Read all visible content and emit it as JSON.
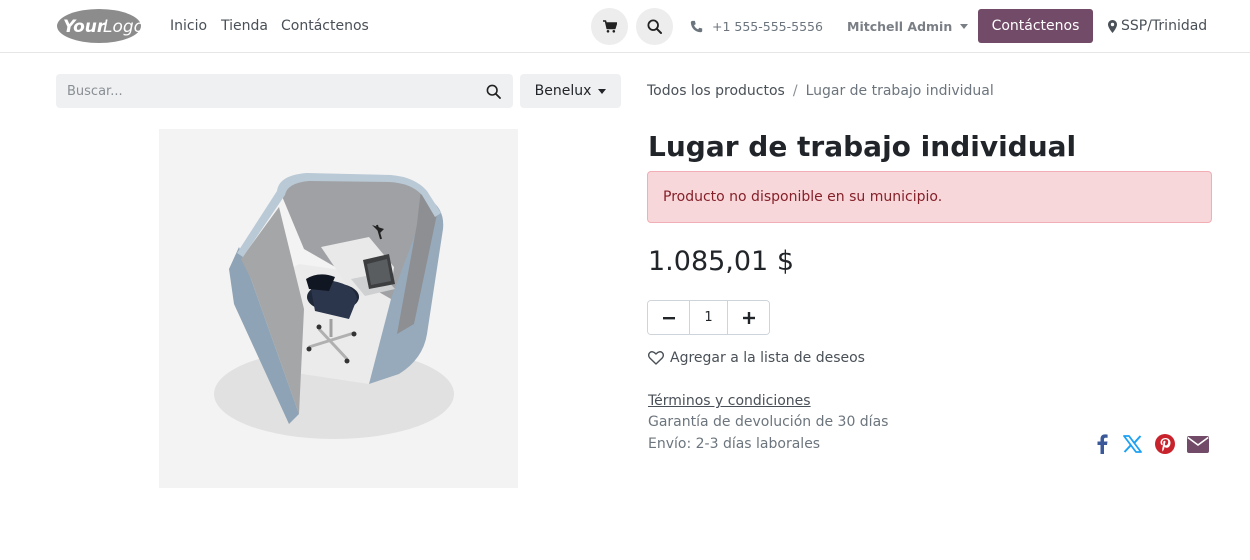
{
  "header": {
    "logo": {
      "text": "Your Logo"
    },
    "nav": [
      "Inicio",
      "Tienda",
      "Contáctenos"
    ],
    "phone": "+1 555-555-5556",
    "user": "Mitchell Admin",
    "contact_button": "Contáctenos",
    "location": "SSP/Trinidad"
  },
  "search": {
    "placeholder": "Buscar...",
    "value": ""
  },
  "pricelist": {
    "label": "Benelux"
  },
  "breadcrumb": {
    "parent": "Todos los productos",
    "separator": "/",
    "current": "Lugar de trabajo individual"
  },
  "product": {
    "name": "Lugar de trabajo individual",
    "alert": "Producto no disponible en su municipio.",
    "price": "1.085,01 $",
    "quantity": "1",
    "wishlist_label": "Agregar a la lista de deseos",
    "terms_label": "Términos y condiciones",
    "return_policy": "Garantía de devolución de 30 días",
    "shipping": "Envío: 2-3 días laborales"
  },
  "share": [
    "facebook-icon",
    "x-icon",
    "pinterest-icon",
    "email-icon"
  ],
  "colors": {
    "brand": "#714b67",
    "alert_bg": "#f8d7da",
    "alert_text": "#842029",
    "facebook": "#3b5998",
    "x": "#1da1f2",
    "pinterest": "#c8232c",
    "email": "#714b67"
  }
}
